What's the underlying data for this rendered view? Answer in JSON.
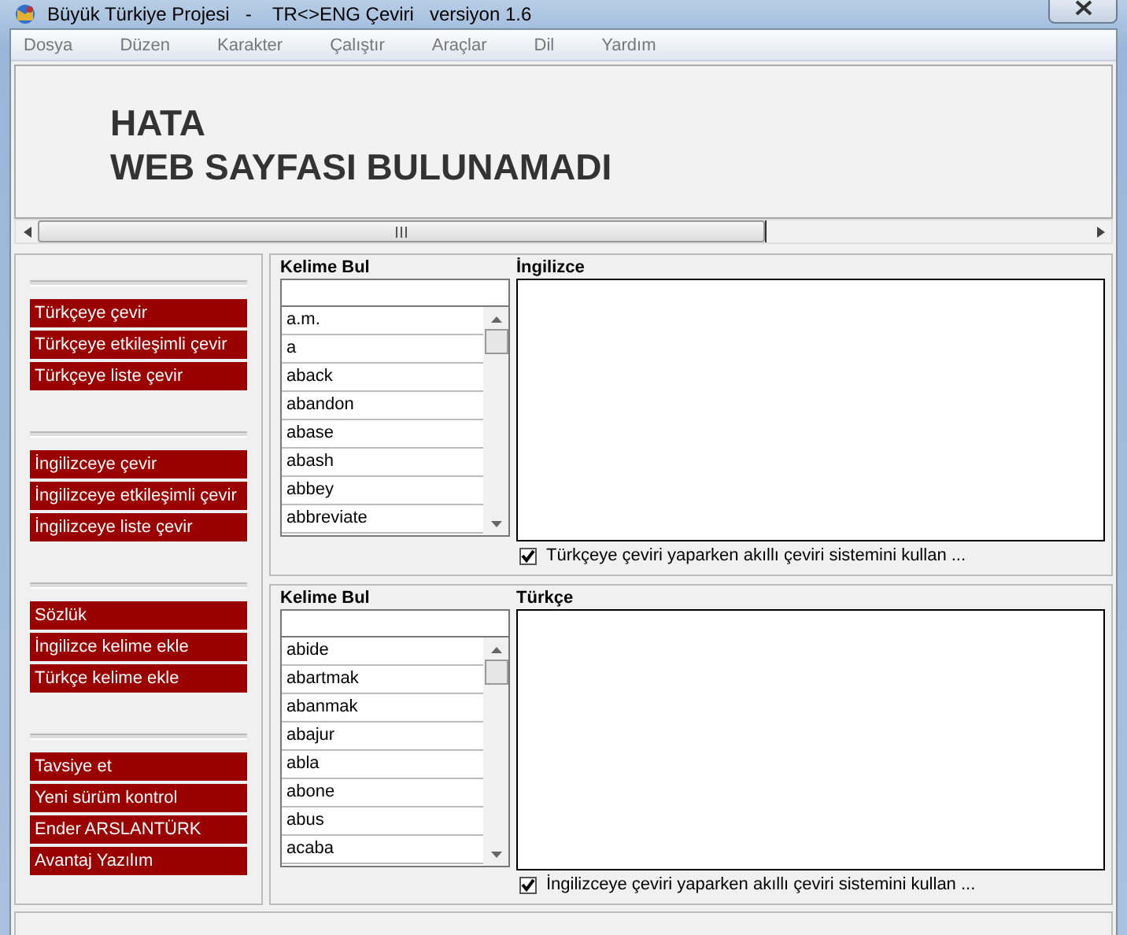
{
  "window": {
    "title": "Büyük Türkiye Projesi   -    TR<>ENG Çeviri   versiyon 1.6"
  },
  "menu": [
    "Dosya",
    "Düzen",
    "Karakter",
    "Çalıştır",
    "Araçlar",
    "Dil",
    "Yardım"
  ],
  "web_page": {
    "heading": [
      "HATA",
      "WEB SAYFASI BULUNAMADI"
    ]
  },
  "sidebar": {
    "groups": [
      [
        "Türkçeye çevir",
        "Türkçeye etkileşimli çevir",
        "Türkçeye liste çevir"
      ],
      [
        "İngilizceye çevir",
        "İngilizceye etkileşimli çevir",
        "İngilizceye liste çevir"
      ],
      [
        "Sözlük",
        "İngilizce kelime ekle",
        "Türkçe kelime ekle"
      ],
      [
        "Tavsiye et",
        "Yeni sürüm kontrol",
        "Ender ARSLANTÜRK",
        "Avantaj Yazılım"
      ]
    ]
  },
  "panels": [
    {
      "search_label": "Kelime Bul",
      "words": [
        "a.m.",
        "a",
        "aback",
        "abandon",
        "abase",
        "abash",
        "abbey",
        "abbreviate"
      ],
      "text_label": "İngilizce",
      "option": {
        "label": "Türkçeye çeviri yaparken akıllı çeviri sistemini kullan ...",
        "checked": true
      }
    },
    {
      "search_label": "Kelime Bul",
      "words": [
        "abide",
        "abartmak",
        "abanmak",
        "abajur",
        "abla",
        "abone",
        "abus",
        "acaba"
      ],
      "text_label": "Türkçe",
      "option": {
        "label": "İngilizceye çeviri yaparken akıllı çeviri sistemini kullan ...",
        "checked": true
      }
    }
  ]
}
